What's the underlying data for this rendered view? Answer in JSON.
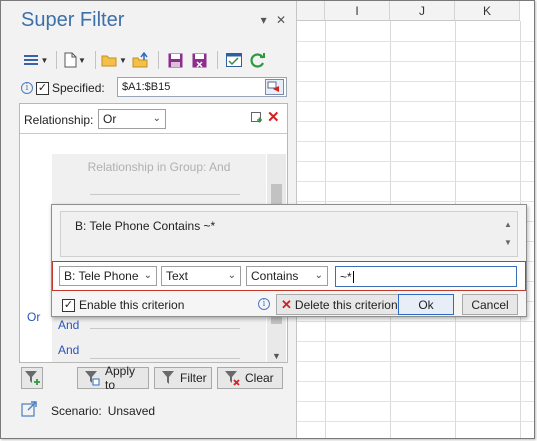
{
  "pane": {
    "title": "Super Filter",
    "pin_glyph": "▾",
    "close_glyph": "✕"
  },
  "toolbar": {
    "icons": [
      "menu-icon",
      "new-file-icon",
      "open-folder-icon",
      "save-as-scenario-icon",
      "save-icon",
      "manage-scenarios-icon",
      "settings-icon",
      "refresh-icon"
    ]
  },
  "specified": {
    "label": "Specified:",
    "checked": true,
    "range": "$A1:$B15"
  },
  "relationship": {
    "label": "Relationship:",
    "value": "Or",
    "group_relationship": "Relationship in Group:   And",
    "outer_label": "Or",
    "and_labels": [
      "And",
      "And"
    ]
  },
  "editor": {
    "preview": "B: Tele Phone  Contains  ~*",
    "column": "B: Tele Phone",
    "type": "Text",
    "operator": "Contains",
    "value": "~*",
    "enable_label": "Enable this criterion",
    "enable_checked": true,
    "delete_label": "Delete this criterion",
    "ok_label": "Ok",
    "cancel_label": "Cancel"
  },
  "actions": {
    "apply_label": "Apply to",
    "filter_label": "Filter",
    "clear_label": "Clear"
  },
  "scenario": {
    "label": "Scenario:",
    "value": "Unsaved"
  },
  "sheet": {
    "columns": [
      "I",
      "J",
      "K"
    ]
  },
  "colors": {
    "title": "#3d6fa8",
    "link_blue": "#2b55b8",
    "delete_red": "#d42020",
    "highlight_border": "#c0392b"
  }
}
